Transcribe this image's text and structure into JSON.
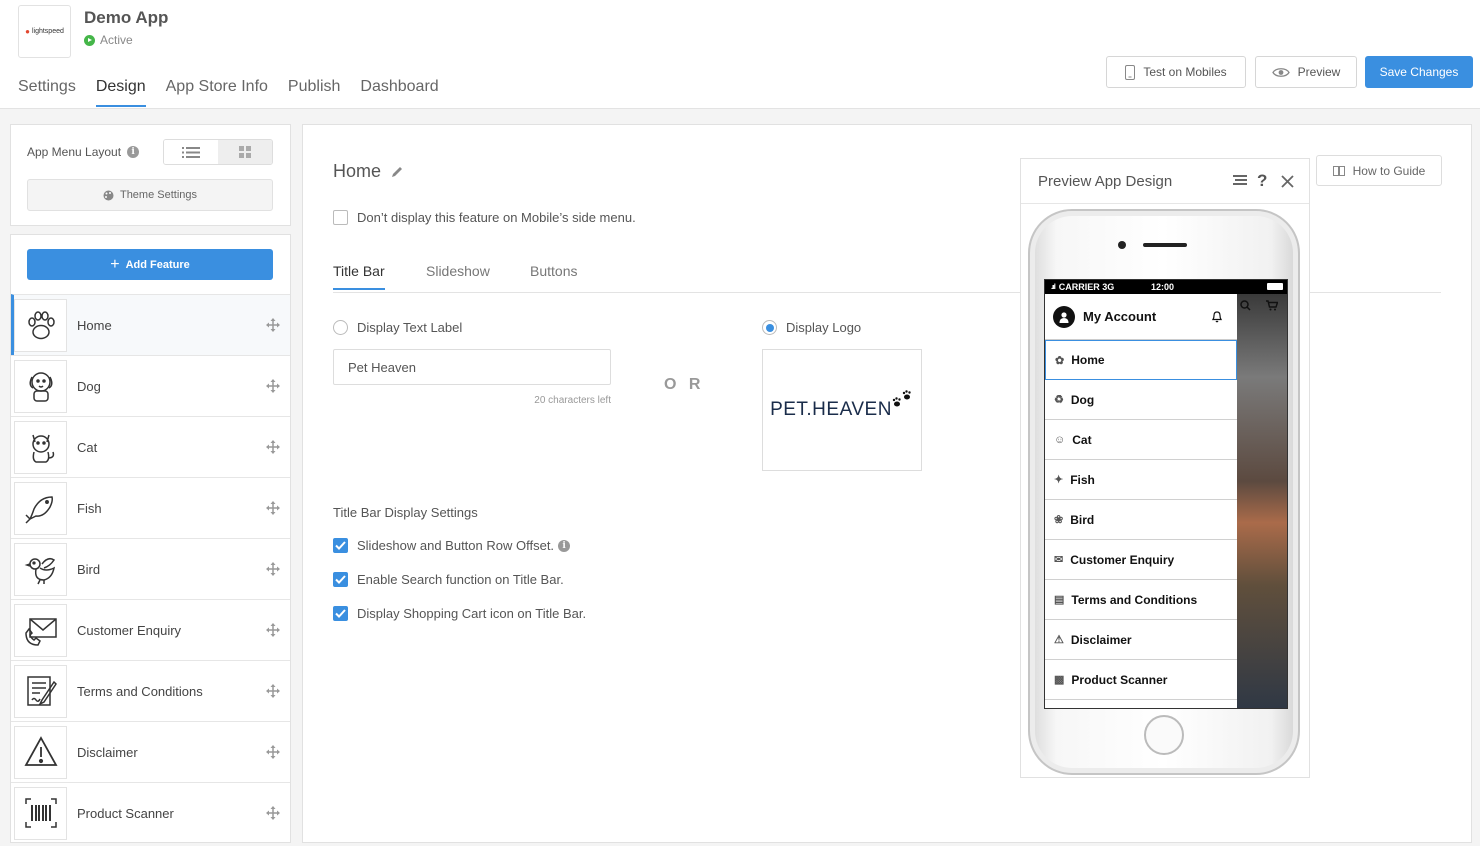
{
  "header": {
    "logo_text": "lightspeed",
    "app_name": "Demo App",
    "status": "Active",
    "tabs": [
      {
        "label": "Settings"
      },
      {
        "label": "Design"
      },
      {
        "label": "App Store Info"
      },
      {
        "label": "Publish"
      },
      {
        "label": "Dashboard"
      }
    ],
    "active_tab": "Design",
    "actions": {
      "test_label": "Test on Mobiles",
      "preview_label": "Preview",
      "save_label": "Save Changes"
    }
  },
  "sidebar": {
    "layout_label": "App Menu Layout",
    "theme_settings_label": "Theme Settings",
    "add_feature_label": "Add Feature",
    "features": [
      {
        "label": "Home",
        "icon": "paw-icon",
        "active": true
      },
      {
        "label": "Dog",
        "icon": "dog-icon"
      },
      {
        "label": "Cat",
        "icon": "cat-icon"
      },
      {
        "label": "Fish",
        "icon": "fish-icon"
      },
      {
        "label": "Bird",
        "icon": "bird-icon"
      },
      {
        "label": "Customer Enquiry",
        "icon": "envelope-phone-icon"
      },
      {
        "label": "Terms and Conditions",
        "icon": "document-pen-icon"
      },
      {
        "label": "Disclaimer",
        "icon": "warning-icon"
      },
      {
        "label": "Product Scanner",
        "icon": "barcode-icon"
      }
    ]
  },
  "editor": {
    "title": "Home",
    "hide_menu_label": "Don’t display this feature on Mobile’s side menu.",
    "subtabs": [
      {
        "label": "Title Bar"
      },
      {
        "label": "Slideshow"
      },
      {
        "label": "Buttons"
      }
    ],
    "active_subtab": "Title Bar",
    "display_text_label": "Display Text Label",
    "display_logo_label": "Display Logo",
    "selected_option": "Display Logo",
    "text_value": "Pet Heaven",
    "chars_left": "20 characters left",
    "or_text": "O R",
    "logo_text": "PET.HEAVEN",
    "settings_heading": "Title Bar Display Settings",
    "settings": [
      {
        "label": "Slideshow and Button Row Offset.",
        "checked": true,
        "info": true
      },
      {
        "label": "Enable Search function on Title Bar.",
        "checked": true
      },
      {
        "label": "Display Shopping Cart icon on Title Bar.",
        "checked": true
      }
    ],
    "how_to_label": "How to Guide"
  },
  "preview": {
    "title": "Preview App Design",
    "carrier": "CARRIER 3G",
    "time": "12:00",
    "account_label": "My Account",
    "menu": [
      "Home",
      "Dog",
      "Cat",
      "Fish",
      "Bird",
      "Customer Enquiry",
      "Terms and Conditions",
      "Disclaimer",
      "Product Scanner"
    ]
  },
  "colors": {
    "accent": "#3a8fe0",
    "status": "#45b649",
    "brand_flame": "#e2462e"
  }
}
